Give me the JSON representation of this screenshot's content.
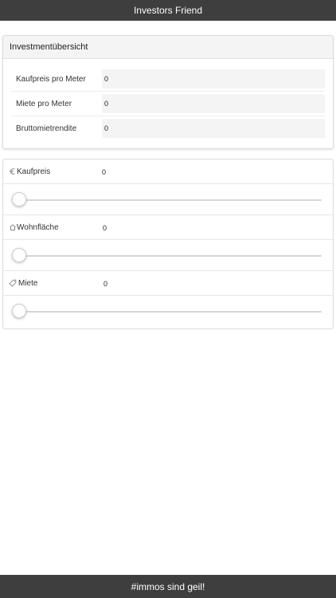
{
  "header": {
    "title": "Investors Friend"
  },
  "overview": {
    "title": "Investmentübersicht",
    "rows": [
      {
        "label": "Kaufpreis pro Meter",
        "value": "0"
      },
      {
        "label": "Miete pro Meter",
        "value": "0"
      },
      {
        "label": "Bruttomietrendite",
        "value": "0"
      }
    ]
  },
  "inputs": [
    {
      "label": "Kaufpreis",
      "value": "0",
      "slider_fraction": 0,
      "icon": "euro-icon"
    },
    {
      "label": "Wohnfläche",
      "value": "0",
      "slider_fraction": 0,
      "icon": "house-icon"
    },
    {
      "label": "Miete",
      "value": "0",
      "slider_fraction": 0,
      "icon": "tag-icon"
    }
  ],
  "footer": {
    "text": "#immos sind geil!"
  },
  "colors": {
    "bar": "#3e3e3e",
    "field": "#f4f4f4",
    "border": "#dcdcdc"
  }
}
